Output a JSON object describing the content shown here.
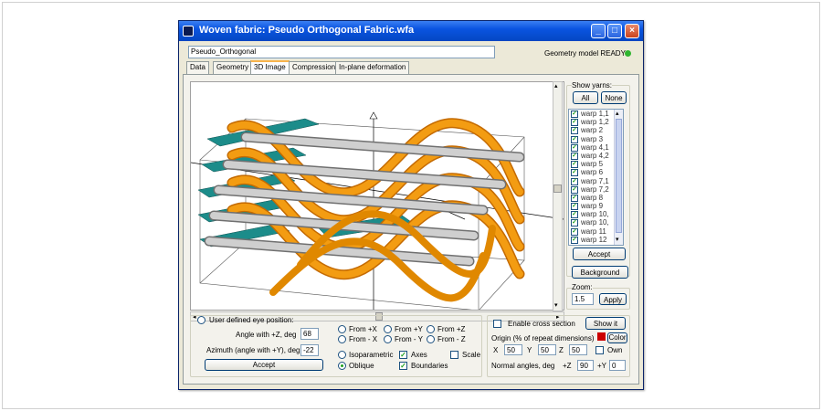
{
  "window": {
    "title": "Woven fabric: Pseudo Orthogonal Fabric.wfa"
  },
  "name_field": {
    "value": "Pseudo_Orthogonal"
  },
  "status": {
    "text": "Geometry model READY",
    "color": "#2fb42f"
  },
  "tabs": [
    "Data",
    "Geometry",
    "3D Image",
    "Compression",
    "In-plane deformation"
  ],
  "active_tab": "3D Image",
  "colors": {
    "accent": "#f39c12",
    "grey_yarn": "#b4b4b4",
    "teal_yarn": "#1c8c8a"
  },
  "yarns_group": {
    "label": "Show yarns:",
    "all_label": "All",
    "none_label": "None",
    "items": [
      "warp 1,1",
      "warp 1,2",
      "warp 2",
      "warp 3",
      "warp 4,1",
      "warp 4,2",
      "warp 5",
      "warp 6",
      "warp 7,1",
      "warp 7,2",
      "warp 8",
      "warp 9",
      "warp 10,",
      "warp 10,",
      "warp 11",
      "warp 12"
    ],
    "accept_label": "Accept"
  },
  "background_label": "Background",
  "zoom": {
    "label": "Zoom:",
    "value": "1.5",
    "apply_label": "Apply"
  },
  "eye": {
    "radio_label": "User defined eye position:",
    "angle_label": "Angle with +Z, deg",
    "angle_value": "68",
    "azimuth_label": "Azimuth (angle with +Y), deg",
    "azimuth_value": "-22",
    "accept_label": "Accept"
  },
  "views": [
    "From +X",
    "From +Y",
    "From +Z",
    "From - X",
    "From - Y",
    "From - Z"
  ],
  "projection": {
    "iso_label": "Isoparametric",
    "oblique_label": "Oblique",
    "selected": "Oblique"
  },
  "options": {
    "axes_label": "Axes",
    "axes_checked": true,
    "scale_label": "Scale",
    "scale_checked": false,
    "boundaries_label": "Boundaries",
    "boundaries_checked": true
  },
  "section": {
    "enable_label": "Enable cross section",
    "show_label": "Show it",
    "origin_label": "Origin (% of repeat dimensions)",
    "color_label": "Color",
    "color_swatch": "#cc0000",
    "x_label": "X",
    "x_value": "50",
    "y_label": "Y",
    "y_value": "50",
    "z_label": "Z",
    "z_value": "50",
    "own_label": "Own",
    "normal_label": "Normal angles, deg",
    "pz_label": "+Z",
    "pz_value": "90",
    "py_label": "+Y",
    "py_value": "0"
  }
}
